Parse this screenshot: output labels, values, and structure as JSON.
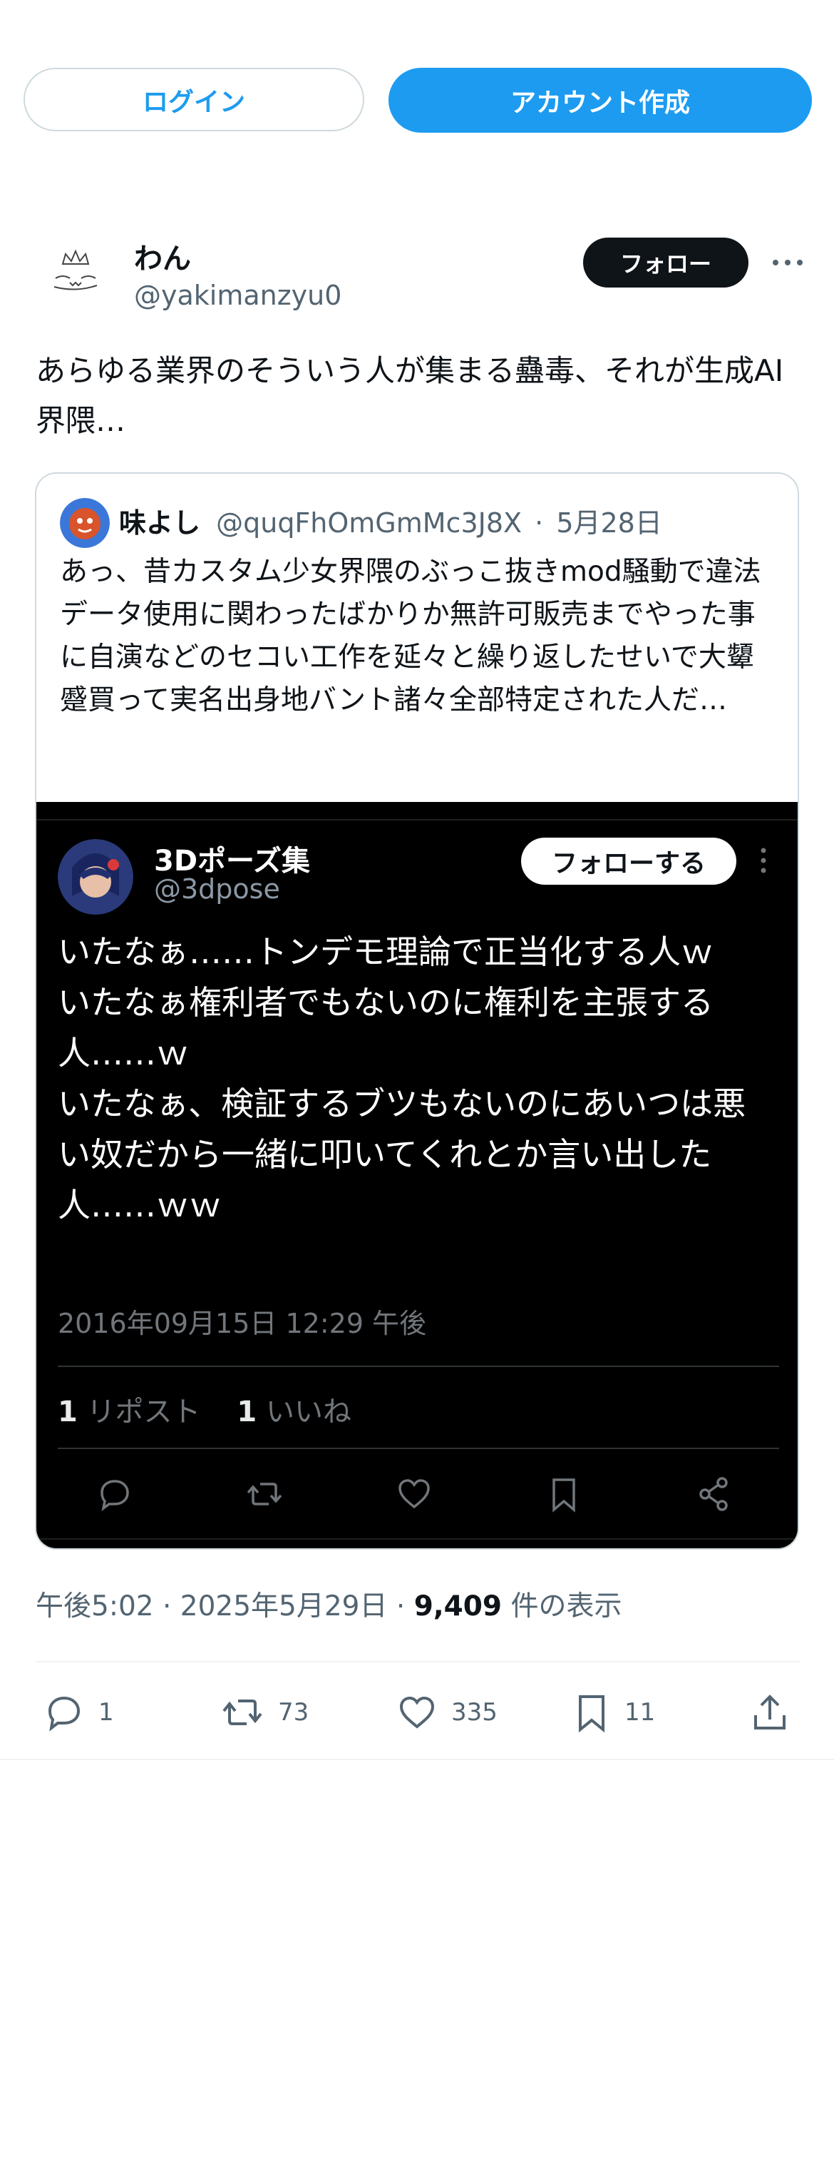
{
  "auth": {
    "login_label": "ログイン",
    "signup_label": "アカウント作成"
  },
  "author": {
    "name": "わん",
    "handle": "@yakimanzyu0",
    "follow_label": "フォロー"
  },
  "tweet": {
    "text": "あらゆる業界のそういう人が集まる蠱毒、それが生成AI界隈…",
    "time": "午後5:02",
    "date": "2025年5月29日",
    "views_count": "9,409",
    "views_label": "件の表示",
    "replies": "1",
    "reposts": "73",
    "likes": "335",
    "bookmarks": "11"
  },
  "quote": {
    "name": "味よし",
    "handle": "@quqFhOmGmMc3J8X",
    "date": "5月28日",
    "text": "あっ、昔カスタム少女界隈のぶっこ抜きmod騒動で違法データ使用に関わったばかりか無許可販売までやった事に自演などのセコい工作を延々と繰り返したせいで大顰蹙買って実名出身地バント諸々全部特定された人だ…"
  },
  "embedded": {
    "name": "3Dポーズ集",
    "handle": "@3dpose",
    "follow_label": "フォローする",
    "text": "いたなぁ……トンデモ理論で正当化する人ｗ\nいたなぁ権利者でもないのに権利を主張する人……ｗ\nいたなぁ、検証するブツもないのにあいつは悪い奴だから一緒に叩いてくれとか言い出した人……ｗｗ",
    "timestamp": "2016年09月15日 12:29 午後",
    "reposts_count": "1",
    "reposts_label": "リポスト",
    "likes_count": "1",
    "likes_label": "いいね"
  },
  "colors": {
    "accent": "#1d9bf0",
    "text_primary": "#0f1419",
    "text_secondary": "#536471",
    "dark_bg": "#000000"
  },
  "icons": [
    "x-logo-icon",
    "more-icon",
    "reply-icon",
    "repost-icon",
    "like-icon",
    "bookmark-icon",
    "share-icon"
  ]
}
